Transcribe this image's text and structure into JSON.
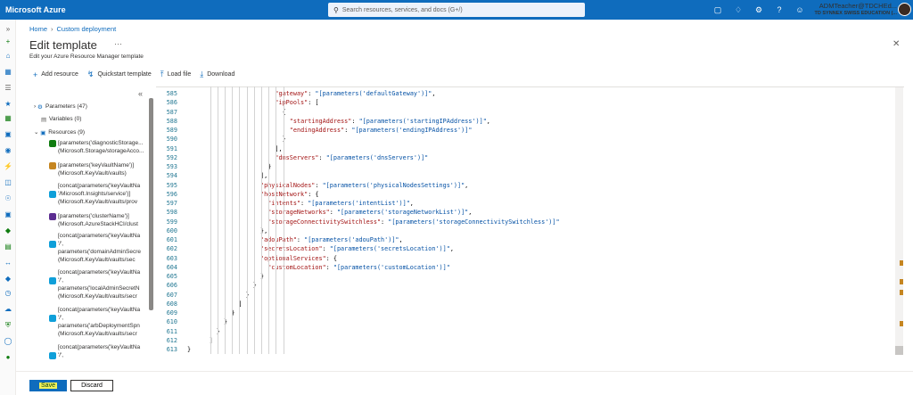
{
  "topbar": {
    "brand": "Microsoft Azure",
    "search_placeholder": "Search resources, services, and docs (G+/)",
    "account_name": "ADMTeacher@TDCHEd...",
    "account_org": "TD SYNNEX SWISS EDUCATION (..."
  },
  "breadcrumb": [
    "Home",
    "Custom deployment"
  ],
  "page": {
    "title": "Edit template",
    "subtitle": "Edit your Azure Resource Manager template"
  },
  "toolbar": {
    "add_resource": "Add resource",
    "quickstart": "Quickstart template",
    "load_file": "Load file",
    "download": "Download"
  },
  "tree": {
    "parameters": "Parameters (47)",
    "variables": "Variables (0)",
    "resources": "Resources (9)",
    "resource_lines": [
      "[parameters('diagnosticStorage...",
      "(Microsoft.Storage/storageAcco...",
      "[parameters('keyVaultName')]",
      "(Microsoft.KeyVault/vaults)",
      "[concat(parameters('keyVaultNa",
      "'/Microsoft.Insights/service')]",
      "(Microsoft.KeyVault/vaults/prov",
      "[parameters('clusterName')]",
      "(Microsoft.AzureStackHCI/clust",
      "[concat(parameters('keyVaultNa",
      "'/',",
      "parameters('domainAdminSecre",
      "(Microsoft.KeyVault/vaults/sec",
      "[concat(parameters('keyVaultNa",
      "'/',",
      "parameters('localAdminSecretN",
      "(Microsoft.KeyVault/vaults/secr",
      "[concat(parameters('keyVaultNa",
      "'/',",
      "parameters('arbDeploymentSpn",
      "(Microsoft.KeyVault/vaults/secr",
      "[concat(parameters('keyVaultNa",
      "'/',"
    ]
  },
  "editor": {
    "line_numbers": [
      "585",
      "586",
      "587",
      "588",
      "589",
      "590",
      "591",
      "592",
      "593",
      "594",
      "595",
      "596",
      "597",
      "598",
      "599",
      "600",
      "601",
      "602",
      "603",
      "604",
      "605",
      "606",
      "607",
      "608",
      "609",
      "610",
      "611",
      "612",
      "613"
    ],
    "lines": [
      {
        "k": "\"gateway\"",
        "rest": ": ",
        "s": "\"[parameters('defaultGateway')]\"",
        "end": ","
      },
      {
        "k": "\"ipPools\"",
        "rest": ": [",
        "s": "",
        "end": ""
      },
      {
        "k": "",
        "rest": "{",
        "s": "",
        "end": ""
      },
      {
        "k": "\"startingAddress\"",
        "rest": ": ",
        "s": "\"[parameters('startingIPAddress')]\"",
        "end": ","
      },
      {
        "k": "\"endingAddress\"",
        "rest": ": ",
        "s": "\"[parameters('endingIPAddress')]\"",
        "end": ""
      },
      {
        "k": "",
        "rest": "}",
        "s": "",
        "end": ""
      },
      {
        "k": "",
        "rest": "],",
        "s": "",
        "end": ""
      },
      {
        "k": "\"dnsServers\"",
        "rest": ": ",
        "s": "\"[parameters('dnsServers')]\"",
        "end": ""
      },
      {
        "k": "",
        "rest": "}",
        "s": "",
        "end": ""
      },
      {
        "k": "",
        "rest": "],",
        "s": "",
        "end": ""
      },
      {
        "k": "\"physicalNodes\"",
        "rest": ": ",
        "s": "\"[parameters('physicalNodesSettings')]\"",
        "end": ","
      },
      {
        "k": "\"hostNetwork\"",
        "rest": ": {",
        "s": "",
        "end": ""
      },
      {
        "k": "\"intents\"",
        "rest": ": ",
        "s": "\"[parameters('intentList')]\"",
        "end": ","
      },
      {
        "k": "\"storageNetworks\"",
        "rest": ": ",
        "s": "\"[parameters('storageNetworkList')]\"",
        "end": ","
      },
      {
        "k": "\"storageConnectivitySwitchless\"",
        "rest": ": ",
        "s": "\"[parameters('storageConnectivitySwitchless')]\"",
        "end": ""
      },
      {
        "k": "",
        "rest": "},",
        "s": "",
        "end": ""
      },
      {
        "k": "\"adouPath\"",
        "rest": ": ",
        "s": "\"[parameters('adouPath')]\"",
        "end": ","
      },
      {
        "k": "\"secretsLocation\"",
        "rest": ": ",
        "s": "\"[parameters('secretsLocation')]\"",
        "end": ","
      },
      {
        "k": "\"optionalServices\"",
        "rest": ": {",
        "s": "",
        "end": ""
      },
      {
        "k": "\"customLocation\"",
        "rest": ": ",
        "s": "\"[parameters('customLocation')]\"",
        "end": ""
      },
      {
        "k": "",
        "rest": "}",
        "s": "",
        "end": ""
      },
      {
        "k": "",
        "rest": "}",
        "s": "",
        "end": ""
      },
      {
        "k": "",
        "rest": "}",
        "s": "",
        "end": ""
      },
      {
        "k": "",
        "rest": "]",
        "s": "",
        "end": ""
      },
      {
        "k": "",
        "rest": "}",
        "s": "",
        "end": ""
      },
      {
        "k": "",
        "rest": "}",
        "s": "",
        "end": ""
      },
      {
        "k": "",
        "rest": "}",
        "s": "",
        "end": ""
      },
      {
        "k": "",
        "rest": "]",
        "s": "",
        "end": ""
      },
      {
        "k": "",
        "rest": "}",
        "s": "",
        "end": ""
      }
    ]
  },
  "footer": {
    "save": "Save",
    "discard": "Discard"
  },
  "colors": {
    "accent": "#0f6cbd",
    "json_key": "#a31515",
    "json_string": "#0451a5"
  }
}
